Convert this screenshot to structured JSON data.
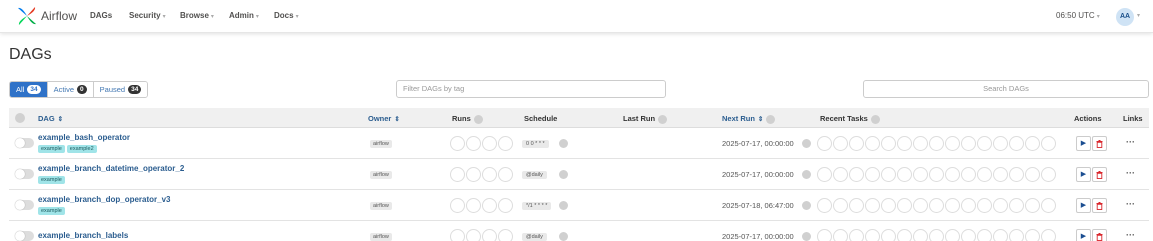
{
  "nav": {
    "brand": "Airflow",
    "items": [
      "DAGs",
      "Security",
      "Browse",
      "Admin",
      "Docs"
    ],
    "time": "06:50 UTC",
    "avatar": "AA"
  },
  "page": {
    "title": "DAGs"
  },
  "filters": {
    "all_label": "All",
    "all_count": "34",
    "active_label": "Active",
    "active_count": "0",
    "paused_label": "Paused",
    "paused_count": "34",
    "tag_placeholder": "Filter DAGs by tag",
    "search_placeholder": "Search DAGs"
  },
  "table": {
    "headers": {
      "dag": "DAG",
      "owner": "Owner",
      "runs": "Runs",
      "schedule": "Schedule",
      "last_run": "Last Run",
      "next_run": "Next Run",
      "recent_tasks": "Recent Tasks",
      "actions": "Actions",
      "links": "Links"
    },
    "rows": [
      {
        "name": "example_bash_operator",
        "tags": [
          "example",
          "example2"
        ],
        "owner": "airflow",
        "schedule": "0 0 * * *",
        "next_run": "2025-07-17, 00:00:00"
      },
      {
        "name": "example_branch_datetime_operator_2",
        "tags": [
          "example"
        ],
        "owner": "airflow",
        "schedule": "@daily",
        "next_run": "2025-07-17, 00:00:00"
      },
      {
        "name": "example_branch_dop_operator_v3",
        "tags": [
          "example"
        ],
        "owner": "airflow",
        "schedule": "*/1 * * * *",
        "next_run": "2025-07-18, 06:47:00"
      },
      {
        "name": "example_branch_labels",
        "tags": [],
        "owner": "airflow",
        "schedule": "@daily",
        "next_run": "2025-07-17, 00:00:00"
      }
    ]
  },
  "icons": {
    "play": "play-icon",
    "delete": "trash-icon",
    "more": "ellipsis-icon",
    "info": "info-icon",
    "sort": "sort-icon"
  },
  "colors": {
    "accent": "#2f72c8",
    "link": "#2b5d8f",
    "tag_bg": "#a0e4e8",
    "delete": "#d9262c"
  }
}
